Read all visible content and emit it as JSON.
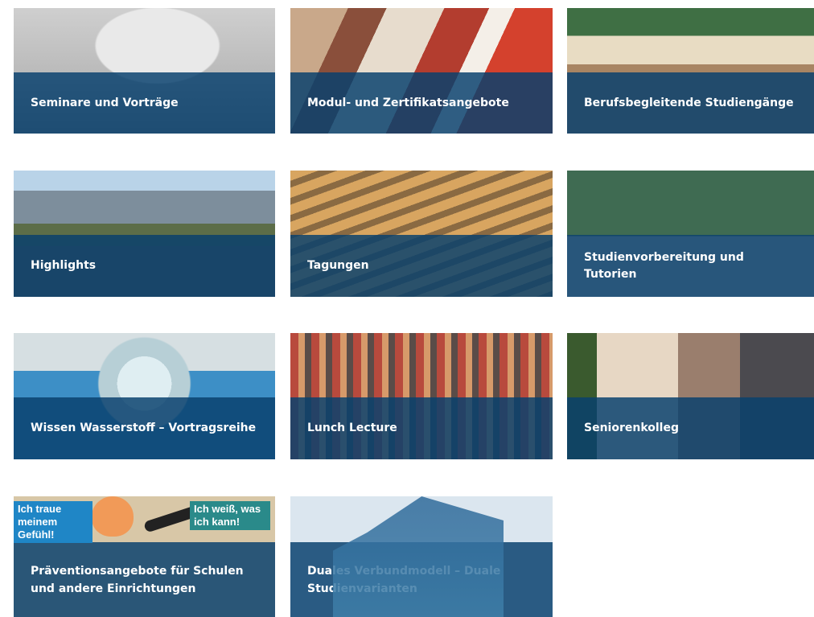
{
  "tiles": [
    {
      "label": "Seminare und Vorträge"
    },
    {
      "label": "Modul- und Zertifikatsangebote"
    },
    {
      "label": "Berufsbegleitende Studiengänge"
    },
    {
      "label": "Highlights"
    },
    {
      "label": "Tagungen"
    },
    {
      "label": "Studienvorbereitung und Tutorien"
    },
    {
      "label": "Wissen Wasserstoff – Vortragsreihe"
    },
    {
      "label": "Lunch Lecture"
    },
    {
      "label": "Seniorenkolleg"
    },
    {
      "label": "Präventionsangebote für Schulen und andere Einrichtungen"
    },
    {
      "label": "Duales Verbundmodell – Duale Studienvarianten"
    }
  ],
  "praevention_stickers": {
    "left": "Ich traue meinem Gefühl!",
    "right": "Ich weiß, was ich kann!"
  },
  "colors": {
    "band": "#08406e",
    "label_text": "#ffffff",
    "page_background": "#ffffff"
  }
}
